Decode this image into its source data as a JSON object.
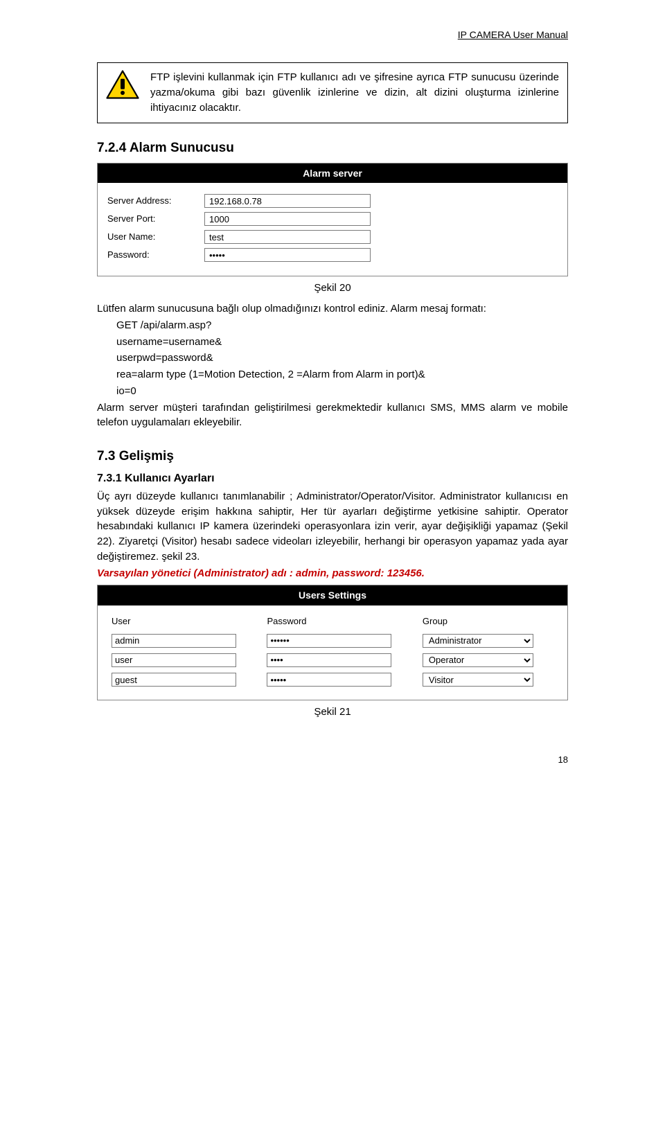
{
  "doc": {
    "header": "IP CAMERA User Manual",
    "page_number": "18"
  },
  "callout": {
    "text": "FTP işlevini kullanmak için FTP kullanıcı adı ve şifresine ayrıca FTP sunucusu üzerinde yazma/okuma gibi bazı güvenlik izinlerine ve dizin, alt dizini oluşturma izinlerine   ihtiyacınız olacaktır."
  },
  "section_724": {
    "heading": "7.2.4   Alarm Sunucusu",
    "panel": {
      "title": "Alarm server",
      "rows": [
        {
          "label": "Server Address:",
          "value": "192.168.0.78",
          "type": "text"
        },
        {
          "label": "Server Port:",
          "value": "1000",
          "type": "text"
        },
        {
          "label": "User Name:",
          "value": "test",
          "type": "text"
        },
        {
          "label": "Password:",
          "value": "•••••",
          "type": "password"
        }
      ]
    },
    "fig_caption": "Şekil 20",
    "body_lines": [
      "Lütfen alarm sunucusuna bağlı olup olmadığınızı kontrol ediniz. Alarm mesaj formatı:",
      "GET /api/alarm.asp?",
      "username=username&",
      "userpwd=password&",
      "rea=alarm type (1=Motion Detection, 2 =Alarm from Alarm in port)&",
      "io=0"
    ],
    "body_after": "Alarm server müşteri tarafından geliştirilmesi gerekmektedir kullanıcı SMS, MMS   alarm ve mobile telefon uygulamaları ekleyebilir."
  },
  "section_73": {
    "heading": "7.3  Gelişmiş",
    "sub_heading": "7.3.1   Kullanıcı Ayarları",
    "body": "Üç ayrı düzeyde kullanıcı tanımlanabilir ; Administrator/Operator/Visitor. Administrator kullanıcısı en yüksek düzeyde erişim hakkına sahiptir, Her tür ayarları değiştirme yetkisine sahiptir. Operator hesabındaki kullanıcı IP kamera üzerindeki operasyonlara izin verir, ayar değişikliği yapamaz (Şekil 22). Ziyaretçi (Visitor) hesabı sadece videoları izleyebilir, herhangi bir operasyon yapamaz yada ayar değiştiremez. şekil 23.",
    "default_admin": "Varsayılan yönetici (Administrator) adı : admin, password: 123456.",
    "panel": {
      "title": "Users Settings",
      "headers": [
        "User",
        "Password",
        "Group"
      ],
      "rows": [
        {
          "user": "admin",
          "password": "••••••",
          "group": "Administrator"
        },
        {
          "user": "user",
          "password": "••••",
          "group": "Operator"
        },
        {
          "user": "guest",
          "password": "•••••",
          "group": "Visitor"
        }
      ]
    },
    "fig_caption": "Şekil 21"
  }
}
